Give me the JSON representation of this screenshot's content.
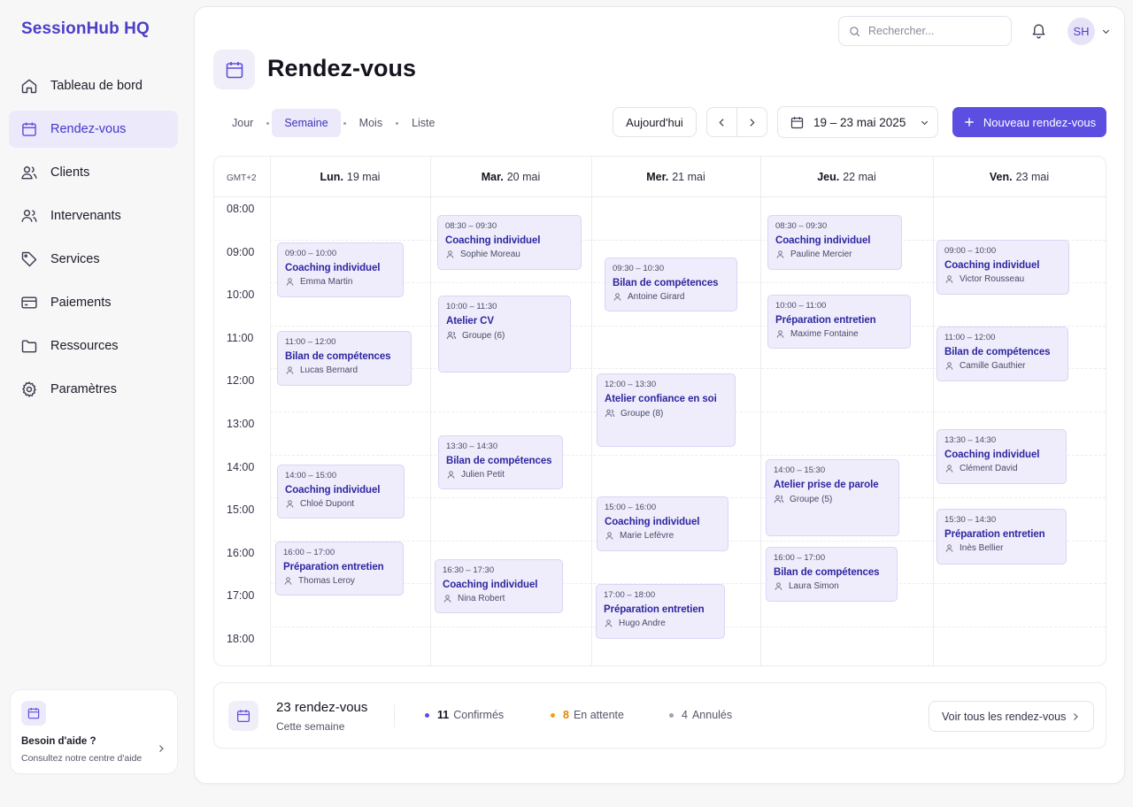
{
  "brand": "SessionHub HQ",
  "sidebar": {
    "items": [
      {
        "label": "Tableau de bord",
        "icon": "home-icon"
      },
      {
        "label": "Rendez-vous",
        "icon": "calendar-icon",
        "active": true
      },
      {
        "label": "Clients",
        "icon": "users-icon"
      },
      {
        "label": "Intervenants",
        "icon": "team-icon"
      },
      {
        "label": "Services",
        "icon": "tag-icon"
      },
      {
        "label": "Paiements",
        "icon": "card-icon"
      },
      {
        "label": "Ressources",
        "icon": "folder-icon"
      },
      {
        "label": "Paramètres",
        "icon": "gear-icon"
      }
    ],
    "help": {
      "title": "Besoin d'aide ?",
      "subtitle": "Consultez notre centre d'aide"
    }
  },
  "header": {
    "search_placeholder": "Rechercher...",
    "avatar_initials": "SH"
  },
  "page": {
    "title": "Rendez-vous",
    "views": [
      {
        "label": "Jour"
      },
      {
        "label": "Semaine",
        "active": true
      },
      {
        "label": "Mois"
      },
      {
        "label": "Liste"
      }
    ],
    "today_label": "Aujourd'hui",
    "date_range": "19 – 23 mai 2025",
    "new_button_label": "Nouveau rendez-vous"
  },
  "calendar": {
    "timezone": "GMT+2",
    "hours": [
      "08:00",
      "09:00",
      "10:00",
      "11:00",
      "12:00",
      "13:00",
      "14:00",
      "15:00",
      "16:00",
      "17:00",
      "18:00"
    ],
    "days": [
      {
        "dow": "Lun.",
        "date": "19 mai"
      },
      {
        "dow": "Mar.",
        "date": "20 mai"
      },
      {
        "dow": "Mer.",
        "date": "21 mai"
      },
      {
        "dow": "Jeu.",
        "date": "22 mai"
      },
      {
        "dow": "Ven.",
        "date": "23 mai"
      }
    ],
    "events": [
      {
        "day": 0,
        "time": "09:00 – 10:00",
        "title": "Coaching individuel",
        "person": "Emma Martin",
        "group": false
      },
      {
        "day": 0,
        "time": "11:00 – 12:00",
        "title": "Bilan de compétences",
        "person": "Lucas Bernard",
        "group": false
      },
      {
        "day": 0,
        "time": "14:00 – 15:00",
        "title": "Coaching individuel",
        "person": "Chloé Dupont",
        "group": false
      },
      {
        "day": 0,
        "time": "16:00 – 17:00",
        "title": "Préparation entretien",
        "person": "Thomas Leroy",
        "group": false
      },
      {
        "day": 1,
        "time": "08:30 – 09:30",
        "title": "Coaching individuel",
        "person": "Sophie Moreau",
        "group": false
      },
      {
        "day": 1,
        "time": "10:00 – 11:30",
        "title": "Atelier CV",
        "person": "Groupe (6)",
        "group": true
      },
      {
        "day": 1,
        "time": "13:30 – 14:30",
        "title": "Bilan de compétences",
        "person": "Julien Petit",
        "group": false
      },
      {
        "day": 1,
        "time": "16:30 – 17:30",
        "title": "Coaching individuel",
        "person": "Nina Robert",
        "group": false
      },
      {
        "day": 2,
        "time": "09:30 – 10:30",
        "title": "Bilan de compétences",
        "person": "Antoine Girard",
        "group": false
      },
      {
        "day": 2,
        "time": "12:00 – 13:30",
        "title": "Atelier confiance en soi",
        "person": "Groupe (8)",
        "group": true
      },
      {
        "day": 2,
        "time": "15:00 – 16:00",
        "title": "Coaching individuel",
        "person": "Marie Lefèvre",
        "group": false
      },
      {
        "day": 2,
        "time": "17:00 – 18:00",
        "title": "Préparation entretien",
        "person": "Hugo Andre",
        "group": false
      },
      {
        "day": 3,
        "time": "08:30 – 09:30",
        "title": "Coaching individuel",
        "person": "Pauline Mercier",
        "group": false
      },
      {
        "day": 3,
        "time": "10:00 – 11:00",
        "title": "Préparation entretien",
        "person": "Maxime Fontaine",
        "group": false
      },
      {
        "day": 3,
        "time": "14:00 – 15:30",
        "title": "Atelier prise de parole",
        "person": "Groupe (5)",
        "group": true
      },
      {
        "day": 3,
        "time": "16:00 – 17:00",
        "title": "Bilan de compétences",
        "person": "Laura Simon",
        "group": false
      },
      {
        "day": 4,
        "time": "09:00 – 10:00",
        "title": "Coaching individuel",
        "person": "Victor Rousseau",
        "group": false
      },
      {
        "day": 4,
        "time": "11:00 – 12:00",
        "title": "Bilan de compétences",
        "person": "Camille Gauthier",
        "group": false
      },
      {
        "day": 4,
        "time": "13:30 – 14:30",
        "title": "Coaching individuel",
        "person": "Clément David",
        "group": false
      },
      {
        "day": 4,
        "time": "15:30 – 14:30",
        "title": "Préparation entretien",
        "person": "Inès Bellier",
        "group": false
      }
    ]
  },
  "summary": {
    "count": "23 rendez-vous",
    "period": "Cette semaine",
    "stats": [
      {
        "value": "11",
        "label": "Confirmés",
        "color": "#5b4ee0"
      },
      {
        "value": "8",
        "label": "En attente",
        "color": "#f59e0b"
      },
      {
        "value": "4",
        "label": "Annulés",
        "color": "#a0a0b0"
      }
    ],
    "view_all_label": "Voir tous les rendez-vous"
  },
  "colors": {
    "accent": "#5b4ee0",
    "accent_soft": "#ece9fb",
    "event_bg": "#efedfb"
  }
}
